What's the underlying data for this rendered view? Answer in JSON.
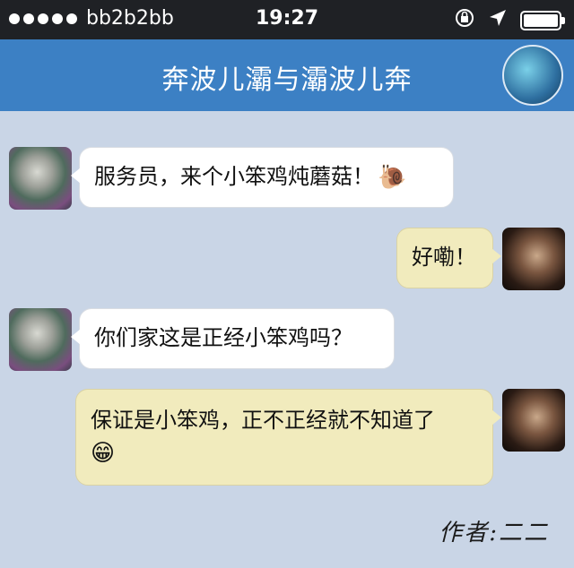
{
  "status_bar": {
    "carrier": "bb2b2bb",
    "time": "19:27",
    "icons": [
      "signal-dots-icon",
      "rotation-lock-icon",
      "location-arrow-icon",
      "battery-icon"
    ]
  },
  "nav": {
    "title": "奔波儿灞与灞波儿奔"
  },
  "messages": [
    {
      "side": "left",
      "text": "服务员，来个小笨鸡炖蘑菇！",
      "emoji": "🐌"
    },
    {
      "side": "right",
      "text": "好嘞！",
      "emoji": ""
    },
    {
      "side": "left",
      "text": "你们家这是正经小笨鸡吗？",
      "emoji": ""
    },
    {
      "side": "right",
      "text": "保证是小笨鸡，正不正经就不知道了",
      "emoji": "😁"
    }
  ],
  "author": "作者:二二",
  "colors": {
    "status_bg": "#1f2125",
    "nav_bg": "#3c80c4",
    "chat_bg": "#c9d5e6",
    "left_bubble": "#ffffff",
    "right_bubble": "#f1ebbd"
  }
}
